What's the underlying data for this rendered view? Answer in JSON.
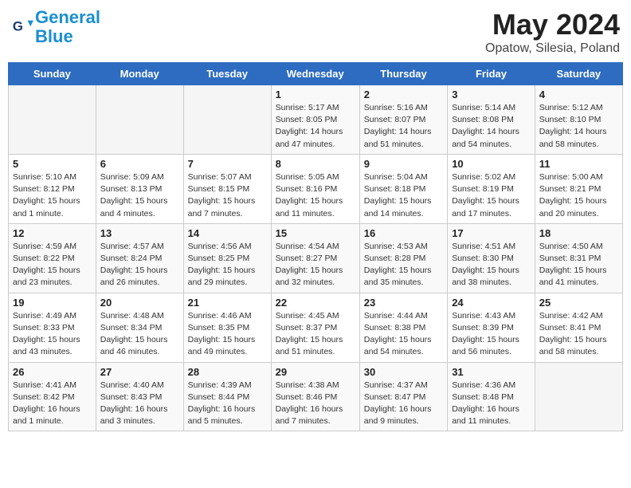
{
  "header": {
    "logo_line1": "General",
    "logo_line2": "Blue",
    "month_title": "May 2024",
    "location": "Opatow, Silesia, Poland"
  },
  "weekdays": [
    "Sunday",
    "Monday",
    "Tuesday",
    "Wednesday",
    "Thursday",
    "Friday",
    "Saturday"
  ],
  "weeks": [
    [
      {
        "day": "",
        "info": ""
      },
      {
        "day": "",
        "info": ""
      },
      {
        "day": "",
        "info": ""
      },
      {
        "day": "1",
        "info": "Sunrise: 5:17 AM\nSunset: 8:05 PM\nDaylight: 14 hours\nand 47 minutes."
      },
      {
        "day": "2",
        "info": "Sunrise: 5:16 AM\nSunset: 8:07 PM\nDaylight: 14 hours\nand 51 minutes."
      },
      {
        "day": "3",
        "info": "Sunrise: 5:14 AM\nSunset: 8:08 PM\nDaylight: 14 hours\nand 54 minutes."
      },
      {
        "day": "4",
        "info": "Sunrise: 5:12 AM\nSunset: 8:10 PM\nDaylight: 14 hours\nand 58 minutes."
      }
    ],
    [
      {
        "day": "5",
        "info": "Sunrise: 5:10 AM\nSunset: 8:12 PM\nDaylight: 15 hours\nand 1 minute."
      },
      {
        "day": "6",
        "info": "Sunrise: 5:09 AM\nSunset: 8:13 PM\nDaylight: 15 hours\nand 4 minutes."
      },
      {
        "day": "7",
        "info": "Sunrise: 5:07 AM\nSunset: 8:15 PM\nDaylight: 15 hours\nand 7 minutes."
      },
      {
        "day": "8",
        "info": "Sunrise: 5:05 AM\nSunset: 8:16 PM\nDaylight: 15 hours\nand 11 minutes."
      },
      {
        "day": "9",
        "info": "Sunrise: 5:04 AM\nSunset: 8:18 PM\nDaylight: 15 hours\nand 14 minutes."
      },
      {
        "day": "10",
        "info": "Sunrise: 5:02 AM\nSunset: 8:19 PM\nDaylight: 15 hours\nand 17 minutes."
      },
      {
        "day": "11",
        "info": "Sunrise: 5:00 AM\nSunset: 8:21 PM\nDaylight: 15 hours\nand 20 minutes."
      }
    ],
    [
      {
        "day": "12",
        "info": "Sunrise: 4:59 AM\nSunset: 8:22 PM\nDaylight: 15 hours\nand 23 minutes."
      },
      {
        "day": "13",
        "info": "Sunrise: 4:57 AM\nSunset: 8:24 PM\nDaylight: 15 hours\nand 26 minutes."
      },
      {
        "day": "14",
        "info": "Sunrise: 4:56 AM\nSunset: 8:25 PM\nDaylight: 15 hours\nand 29 minutes."
      },
      {
        "day": "15",
        "info": "Sunrise: 4:54 AM\nSunset: 8:27 PM\nDaylight: 15 hours\nand 32 minutes."
      },
      {
        "day": "16",
        "info": "Sunrise: 4:53 AM\nSunset: 8:28 PM\nDaylight: 15 hours\nand 35 minutes."
      },
      {
        "day": "17",
        "info": "Sunrise: 4:51 AM\nSunset: 8:30 PM\nDaylight: 15 hours\nand 38 minutes."
      },
      {
        "day": "18",
        "info": "Sunrise: 4:50 AM\nSunset: 8:31 PM\nDaylight: 15 hours\nand 41 minutes."
      }
    ],
    [
      {
        "day": "19",
        "info": "Sunrise: 4:49 AM\nSunset: 8:33 PM\nDaylight: 15 hours\nand 43 minutes."
      },
      {
        "day": "20",
        "info": "Sunrise: 4:48 AM\nSunset: 8:34 PM\nDaylight: 15 hours\nand 46 minutes."
      },
      {
        "day": "21",
        "info": "Sunrise: 4:46 AM\nSunset: 8:35 PM\nDaylight: 15 hours\nand 49 minutes."
      },
      {
        "day": "22",
        "info": "Sunrise: 4:45 AM\nSunset: 8:37 PM\nDaylight: 15 hours\nand 51 minutes."
      },
      {
        "day": "23",
        "info": "Sunrise: 4:44 AM\nSunset: 8:38 PM\nDaylight: 15 hours\nand 54 minutes."
      },
      {
        "day": "24",
        "info": "Sunrise: 4:43 AM\nSunset: 8:39 PM\nDaylight: 15 hours\nand 56 minutes."
      },
      {
        "day": "25",
        "info": "Sunrise: 4:42 AM\nSunset: 8:41 PM\nDaylight: 15 hours\nand 58 minutes."
      }
    ],
    [
      {
        "day": "26",
        "info": "Sunrise: 4:41 AM\nSunset: 8:42 PM\nDaylight: 16 hours\nand 1 minute."
      },
      {
        "day": "27",
        "info": "Sunrise: 4:40 AM\nSunset: 8:43 PM\nDaylight: 16 hours\nand 3 minutes."
      },
      {
        "day": "28",
        "info": "Sunrise: 4:39 AM\nSunset: 8:44 PM\nDaylight: 16 hours\nand 5 minutes."
      },
      {
        "day": "29",
        "info": "Sunrise: 4:38 AM\nSunset: 8:46 PM\nDaylight: 16 hours\nand 7 minutes."
      },
      {
        "day": "30",
        "info": "Sunrise: 4:37 AM\nSunset: 8:47 PM\nDaylight: 16 hours\nand 9 minutes."
      },
      {
        "day": "31",
        "info": "Sunrise: 4:36 AM\nSunset: 8:48 PM\nDaylight: 16 hours\nand 11 minutes."
      },
      {
        "day": "",
        "info": ""
      }
    ]
  ]
}
